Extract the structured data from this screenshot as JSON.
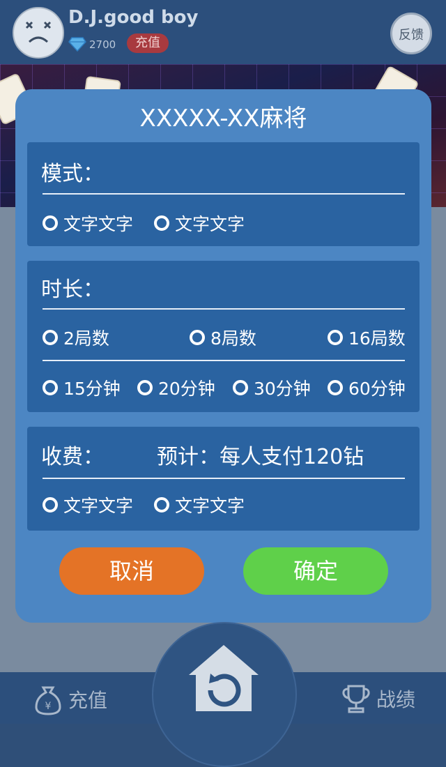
{
  "header": {
    "username": "D.J.good boy",
    "diamond_count": "2700",
    "recharge_badge": "充值",
    "feedback_button": "反馈"
  },
  "dialog": {
    "title": "XXXXX-XX麻将",
    "mode": {
      "label": "模式：",
      "options": [
        "文字文字",
        "文字文字"
      ]
    },
    "duration": {
      "label": "时长：",
      "rounds": [
        "2局数",
        "8局数",
        "16局数"
      ],
      "minutes": [
        "15分钟",
        "20分钟",
        "30分钟",
        "60分钟"
      ]
    },
    "fee": {
      "label": "收费：",
      "estimate": "预计：每人支付120钻",
      "options": [
        "文字文字",
        "文字文字"
      ]
    },
    "cancel_label": "取消",
    "confirm_label": "确定"
  },
  "bottom_nav": {
    "recharge_label": "充值",
    "records_label": "战绩"
  },
  "colors": {
    "dialog_bg": "#4c86c3",
    "panel_bg": "#2a63a1",
    "cancel": "#e47326",
    "confirm": "#5fd04a"
  },
  "icons": [
    "sad-face-icon",
    "diamond-icon",
    "money-bag-icon",
    "home-refresh-icon",
    "trophy-icon"
  ]
}
